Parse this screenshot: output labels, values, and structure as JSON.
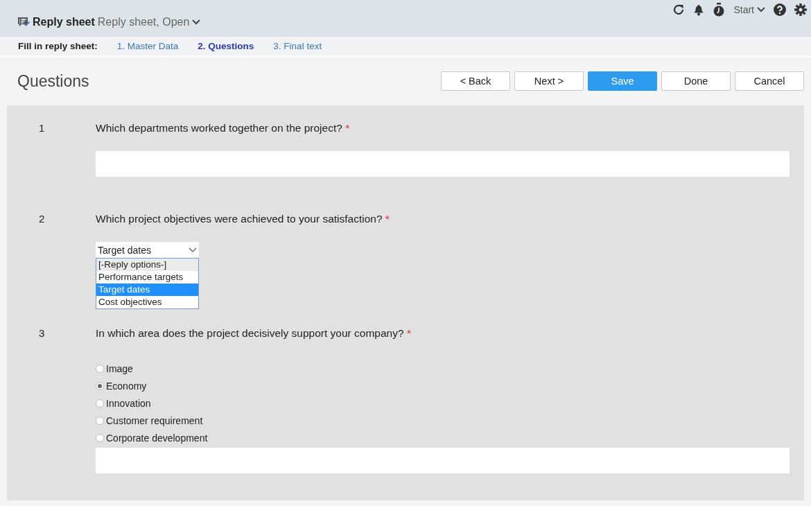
{
  "header": {
    "title": "Reply sheet",
    "subtitle": "Reply sheet, Open",
    "menu_label": "Start"
  },
  "steps": {
    "label": "Fill in reply sheet:",
    "items": [
      {
        "label": "1. Master Data",
        "selected": false
      },
      {
        "label": "2. Questions",
        "selected": true
      },
      {
        "label": "3. Final text",
        "selected": false
      }
    ]
  },
  "page_title": "Questions",
  "buttons": [
    {
      "label": "< Back",
      "kind": "default"
    },
    {
      "label": "Next >",
      "kind": "default"
    },
    {
      "label": "Save",
      "kind": "primary"
    },
    {
      "label": "Done",
      "kind": "default"
    },
    {
      "label": "Cancel",
      "kind": "default"
    }
  ],
  "questions": [
    {
      "number": "1",
      "text": "Which departments worked together on the project?",
      "required_mark": "*",
      "kind": "text"
    },
    {
      "number": "2",
      "text": "Which project objectives were achieved to your satisfaction?",
      "required_mark": "*",
      "kind": "dropdown",
      "value": "Target dates",
      "options": [
        {
          "label": "[-Reply options-]",
          "selected": false
        },
        {
          "label": "Performance targets",
          "selected": false
        },
        {
          "label": "Target dates",
          "selected": true
        },
        {
          "label": "Cost objectives",
          "selected": false
        }
      ]
    },
    {
      "number": "3",
      "text": "In which area does the project decisively support your company?",
      "required_mark": "*",
      "kind": "radio",
      "options": [
        {
          "label": "Image",
          "selected": false
        },
        {
          "label": "Economy",
          "selected": true
        },
        {
          "label": "Innovation",
          "selected": false
        },
        {
          "label": "Customer requirement",
          "selected": false
        },
        {
          "label": "Corporate development",
          "selected": false
        }
      ]
    }
  ]
}
